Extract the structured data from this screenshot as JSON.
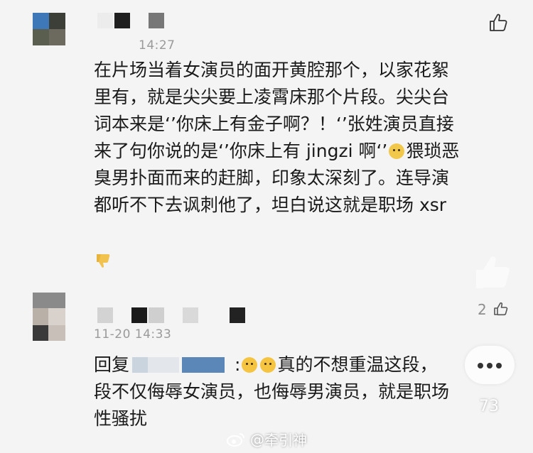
{
  "comments": [
    {
      "time": "14:27",
      "text_lines": [
        "在片场当着女演员的面开黄腔那个，以家花絮",
        "里有，就是尖尖要上凌霄床那个片段。尖尖台",
        "词本来是‘’你床上有金子啊？！‘’张姓演员直接",
        "来了句你说的是‘’你床上有 jingzi 啊‘’",
        "臭男扑面而来的赶脚，印象太深刻了。连导演",
        "都听不下去讽刺他了，坦白说这就是职场 xsr"
      ],
      "line4_after_emoji": "猥琐恶",
      "like_count": "2"
    },
    {
      "time": "11-20 14:33",
      "reply_prefix": "回复",
      "reply_colon": ":",
      "reply_line1_tail": "真的不想重温这段，",
      "text_lines": [
        "段不仅侮辱女演员，也侮辱男演员，就是职场",
        "性骚扰"
      ],
      "count_badge": "73"
    }
  ],
  "watermark": {
    "at": "@",
    "name": "牵引神"
  },
  "colors": {
    "background": "#f4f4f4",
    "text": "#1a1a1a",
    "time": "#9a9a9a",
    "emoji": "#f5c542"
  },
  "icons": [
    "thumbs-up-icon",
    "thumbs-down-icon",
    "crying-emoji-icon",
    "sad-emoji-icon",
    "more-dots-icon",
    "weibo-logo-icon"
  ]
}
